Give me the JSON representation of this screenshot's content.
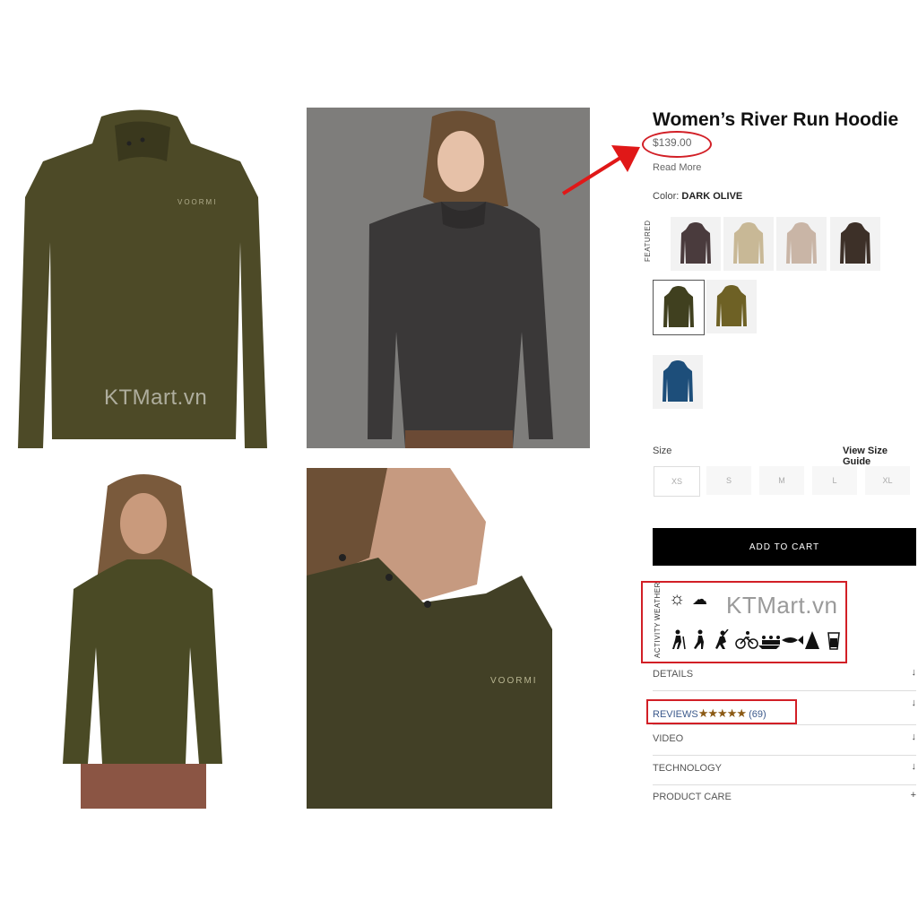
{
  "watermark": "KTMart.vn",
  "product": {
    "title": "Women’s River Run Hoodie",
    "price": "$139.00",
    "read_more": "Read More",
    "color_label": "Color:",
    "color_value": "DARK OLIVE"
  },
  "featured_label": "FEATURED",
  "swatch_colors": [
    "#4a3b3d",
    "#c8b896",
    "#c9b5a6",
    "#3d3028",
    "#40401f",
    "#6e6125",
    "#1d4e7a"
  ],
  "size": {
    "label": "Size",
    "guide": "View Size Guide",
    "options": [
      "XS",
      "S",
      "M",
      "L",
      "XL"
    ]
  },
  "cart_button": "ADD TO CART",
  "features": {
    "weather_label": "WEATHER",
    "activity_label": "ACTIVITY",
    "weather_icons": [
      "sun-icon",
      "cloud-icon"
    ],
    "activity_icons": [
      "hiking-icon",
      "walking-icon",
      "climbing-icon",
      "cycling-icon",
      "rafting-icon",
      "fishing-icon",
      "camping-icon",
      "drink-icon"
    ]
  },
  "accordion": {
    "details": "DETAILS",
    "reviews": "REVIEWS",
    "review_count": "(69)",
    "rating_stars": "★★★★★",
    "video": "VIDEO",
    "technology": "TECHNOLOGY",
    "care": "PRODUCT CARE",
    "toggle_down": "↓",
    "toggle_plus": "+"
  },
  "colors": {
    "olive": "#4a4a25",
    "annotation_red": "#d21f26"
  }
}
